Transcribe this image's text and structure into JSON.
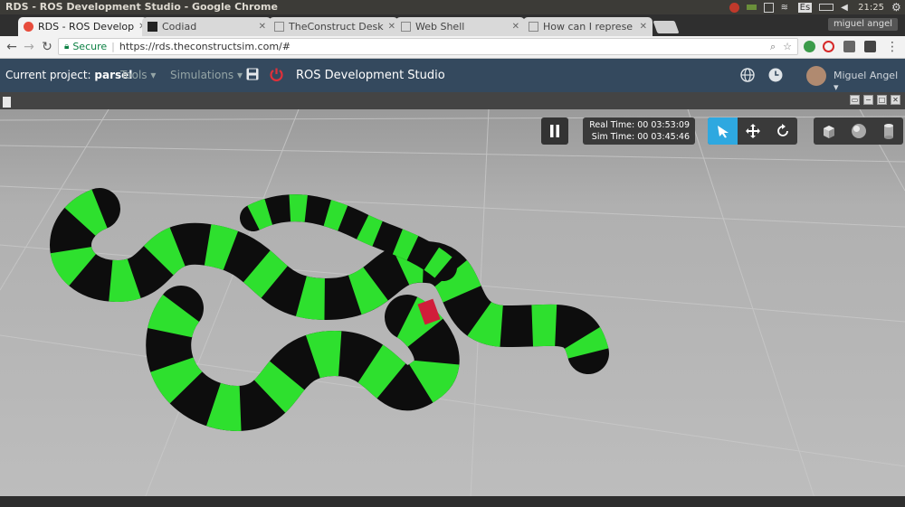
{
  "os": {
    "window_title": "RDS - ROS Development Studio - Google Chrome",
    "clock": "21:25",
    "keyboard": "Es",
    "user_label": "miguel angel"
  },
  "tabs": [
    {
      "label": "RDS - ROS Develop",
      "active": true
    },
    {
      "label": "Codiad",
      "active": false
    },
    {
      "label": "TheConstruct Desk",
      "active": false
    },
    {
      "label": "Web Shell",
      "active": false
    },
    {
      "label": "How can I represe",
      "active": false
    }
  ],
  "address": {
    "secure_label": "Secure",
    "url": "https://rds.theconstructsim.com/#"
  },
  "navbar": {
    "project_prefix": "Current project:",
    "project_name": "parsel",
    "tools_label": "Tools ▾",
    "simulations_label": "Simulations ▾",
    "app_title": "ROS Development Studio",
    "user_name": "Miguel Angel ▾"
  },
  "simulation": {
    "real_time": "Real Time: 00 03:53:09",
    "sim_time": "Sim Time: 00 03:45:46"
  },
  "colors": {
    "navbar": "#34495e",
    "snake_green": "#2ee02e",
    "snake_black": "#0d0d0d",
    "ground": "#b3b3b3",
    "accent": "#2ea8e0"
  },
  "icons": [
    "pause-icon",
    "select-icon",
    "translate-icon",
    "rotate-icon",
    "box-icon",
    "sphere-icon",
    "cylinder-icon",
    "save-icon",
    "power-icon",
    "globe-icon",
    "clock-icon"
  ]
}
